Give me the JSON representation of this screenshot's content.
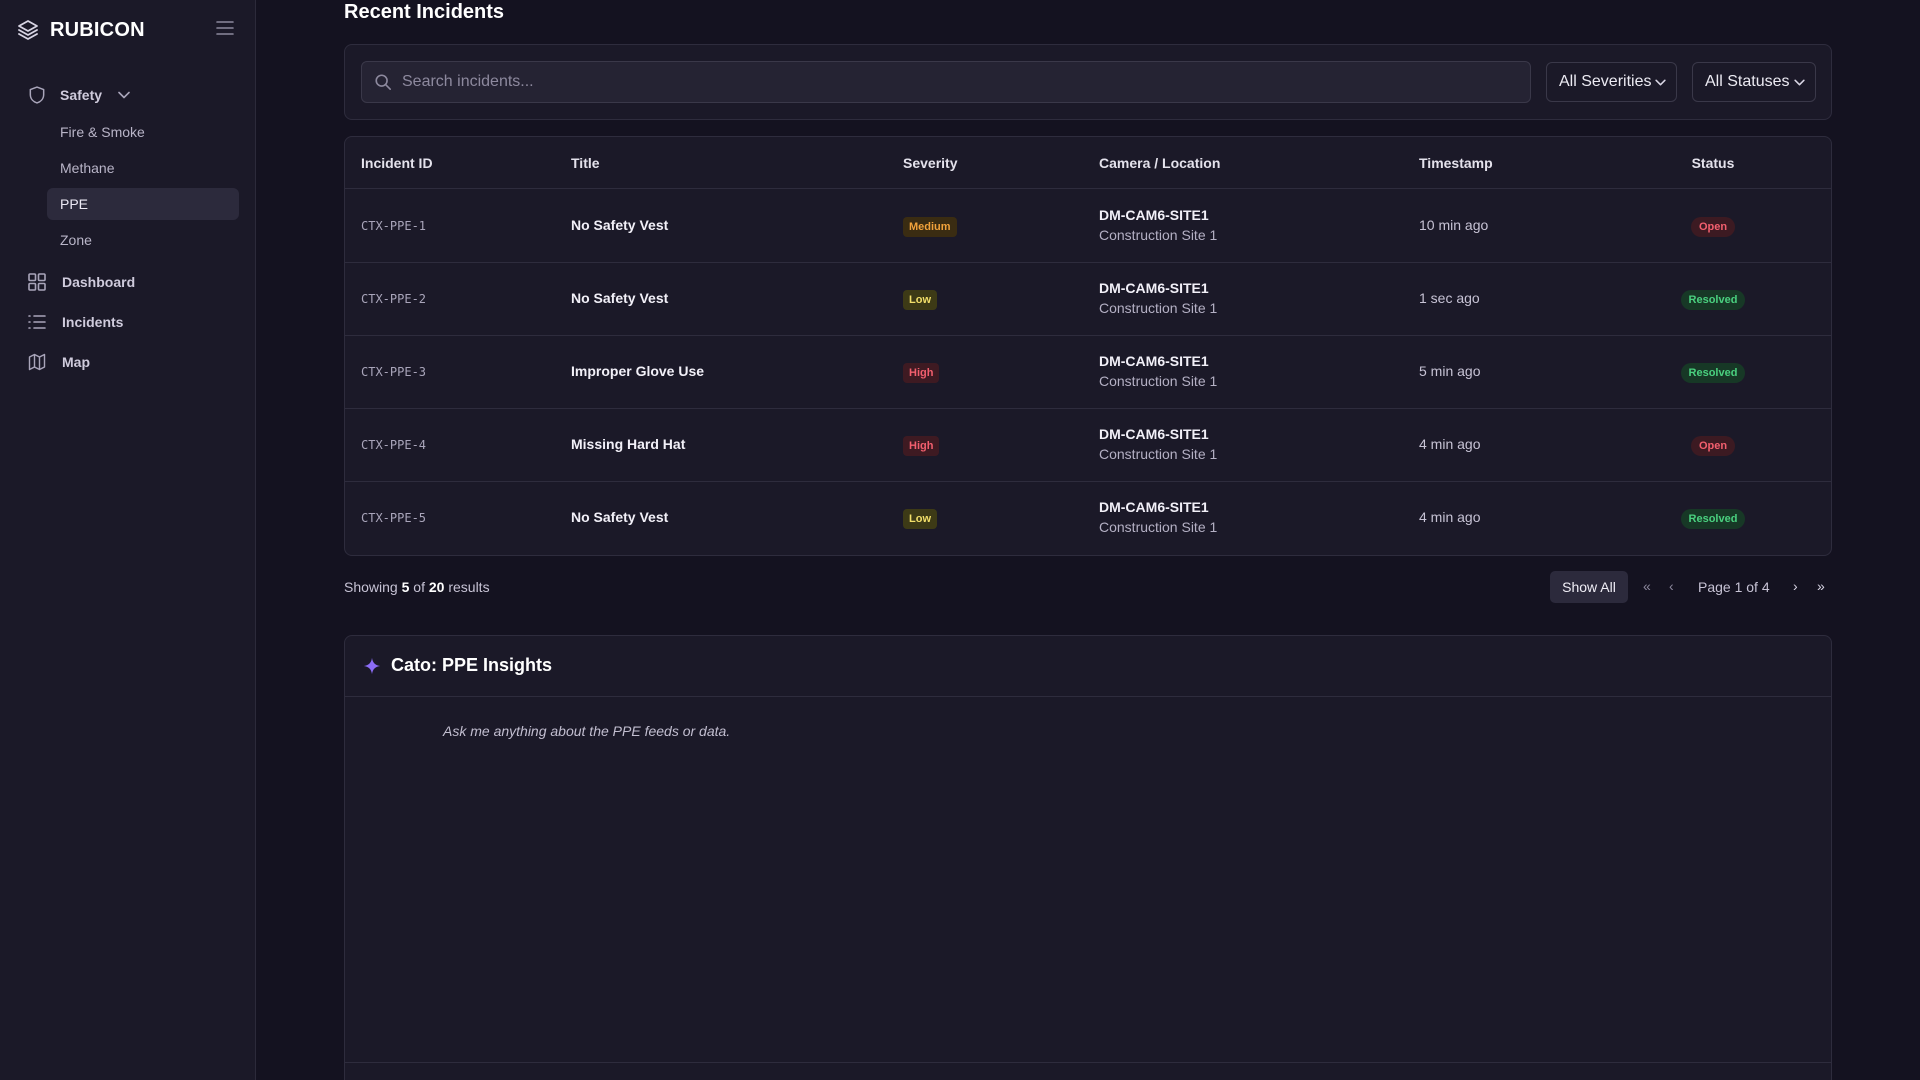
{
  "brand": {
    "name": "RUBICON"
  },
  "sidebar": {
    "group": {
      "label": "Safety",
      "icon": "shield-icon"
    },
    "sub_items": [
      {
        "label": "Fire & Smoke",
        "active": false
      },
      {
        "label": "Methane",
        "active": false
      },
      {
        "label": "PPE",
        "active": true
      },
      {
        "label": "Zone",
        "active": false
      }
    ],
    "items": [
      {
        "label": "Dashboard",
        "icon": "dashboard-grid-icon"
      },
      {
        "label": "Incidents",
        "icon": "list-icon"
      },
      {
        "label": "Map",
        "icon": "map-icon"
      }
    ]
  },
  "main": {
    "title": "Recent Incidents",
    "search": {
      "placeholder": "Search incidents...",
      "value": ""
    },
    "filters": {
      "severity": "All Severities",
      "status": "All Statuses"
    },
    "table": {
      "columns": [
        "Incident ID",
        "Title",
        "Severity",
        "Camera / Location",
        "Timestamp",
        "Status"
      ],
      "rows": [
        {
          "id": "CTX-PPE-1",
          "title": "No Safety Vest",
          "severity": "Medium",
          "camera": "DM-CAM6-SITE1",
          "location": "Construction Site 1",
          "timestamp": "10 min ago",
          "status": "Open"
        },
        {
          "id": "CTX-PPE-2",
          "title": "No Safety Vest",
          "severity": "Low",
          "camera": "DM-CAM6-SITE1",
          "location": "Construction Site 1",
          "timestamp": "1 sec ago",
          "status": "Resolved"
        },
        {
          "id": "CTX-PPE-3",
          "title": "Improper Glove Use",
          "severity": "High",
          "camera": "DM-CAM6-SITE1",
          "location": "Construction Site 1",
          "timestamp": "5 min ago",
          "status": "Resolved"
        },
        {
          "id": "CTX-PPE-4",
          "title": "Missing Hard Hat",
          "severity": "High",
          "camera": "DM-CAM6-SITE1",
          "location": "Construction Site 1",
          "timestamp": "4 min ago",
          "status": "Open"
        },
        {
          "id": "CTX-PPE-5",
          "title": "No Safety Vest",
          "severity": "Low",
          "camera": "DM-CAM6-SITE1",
          "location": "Construction Site 1",
          "timestamp": "4 min ago",
          "status": "Resolved"
        }
      ]
    },
    "results": {
      "prefix": "Showing",
      "shown": "5",
      "of": "of",
      "total": "20",
      "suffix": "results"
    },
    "pagination": {
      "show_all": "Show All",
      "first": "«",
      "prev": "‹",
      "page_info": "Page 1 of 4",
      "next": "›",
      "last": "»"
    },
    "insights": {
      "title": "Cato: PPE Insights",
      "hint": "Ask me anything about the PPE feeds or data.",
      "icon": "sparkle-icon"
    }
  },
  "colors": {
    "accent": "#8b6cf6",
    "background": "#141220",
    "panel": "#1b1928",
    "severity_medium": "#f0a23b",
    "severity_low": "#f2df6a",
    "severity_high": "#f25f6e",
    "status_open": "#f25f6e",
    "status_resolved": "#4ad07f"
  }
}
